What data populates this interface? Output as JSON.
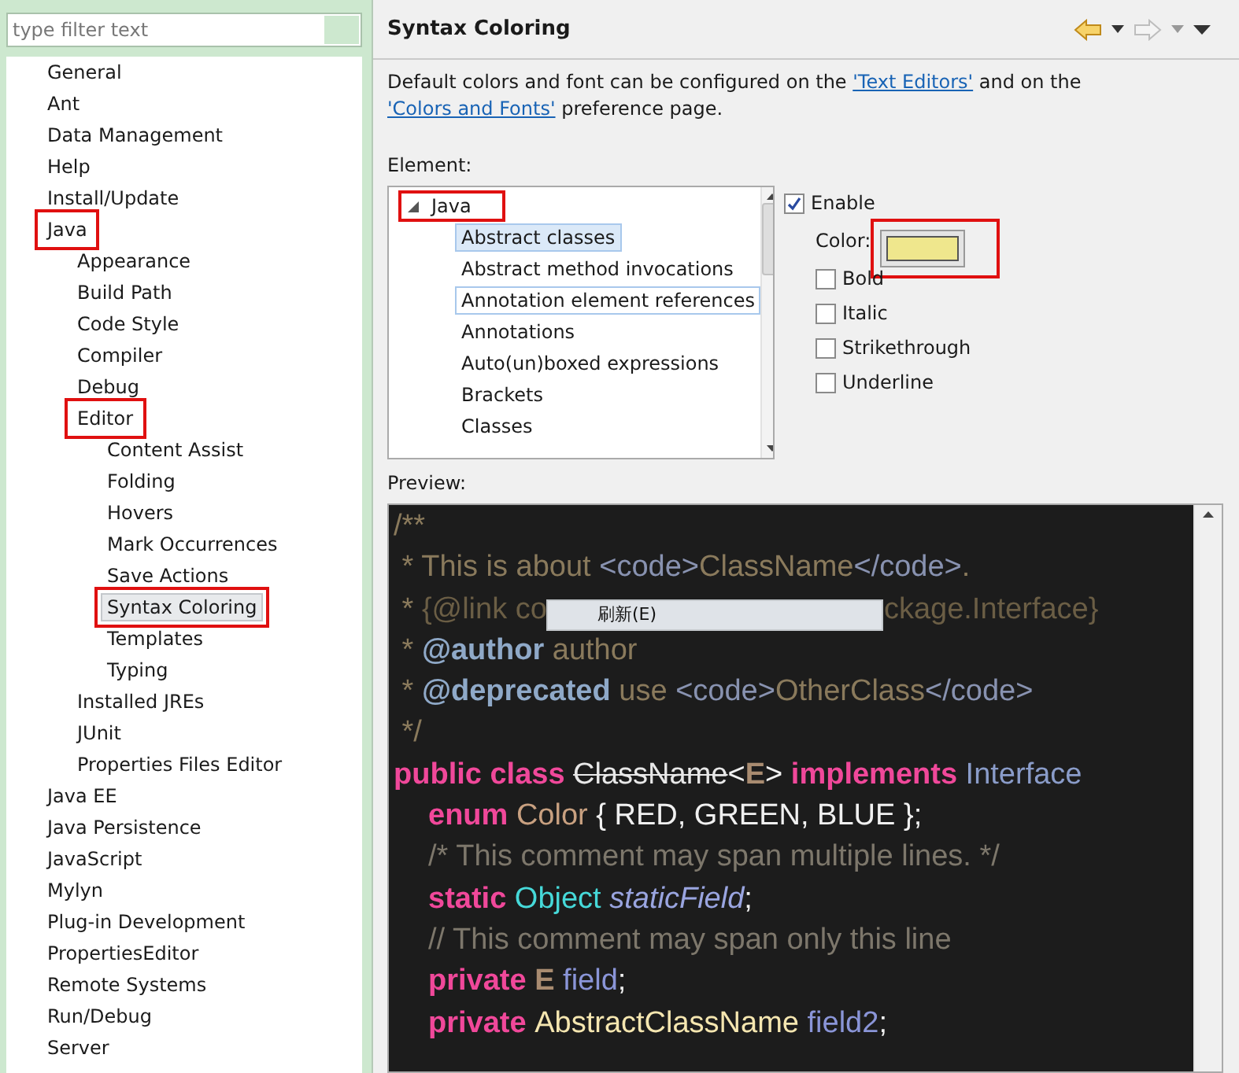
{
  "filter": {
    "placeholder": "type filter text"
  },
  "tree": [
    {
      "label": "General",
      "selected": false,
      "highlighted": false
    },
    {
      "label": "Ant",
      "selected": false,
      "highlighted": false
    },
    {
      "label": "Data Management",
      "selected": false,
      "highlighted": false
    },
    {
      "label": "Help",
      "selected": false,
      "highlighted": false
    },
    {
      "label": "Install/Update",
      "selected": false,
      "highlighted": false
    },
    {
      "label": "Java",
      "selected": false,
      "highlighted": true,
      "children": [
        {
          "label": "Appearance",
          "selected": false,
          "highlighted": false
        },
        {
          "label": "Build Path",
          "selected": false,
          "highlighted": false
        },
        {
          "label": "Code Style",
          "selected": false,
          "highlighted": false
        },
        {
          "label": "Compiler",
          "selected": false,
          "highlighted": false
        },
        {
          "label": "Debug",
          "selected": false,
          "highlighted": false
        },
        {
          "label": "Editor",
          "selected": false,
          "highlighted": true,
          "children": [
            {
              "label": "Content Assist",
              "selected": false,
              "highlighted": false
            },
            {
              "label": "Folding",
              "selected": false,
              "highlighted": false
            },
            {
              "label": "Hovers",
              "selected": false,
              "highlighted": false
            },
            {
              "label": "Mark Occurrences",
              "selected": false,
              "highlighted": false
            },
            {
              "label": "Save Actions",
              "selected": false,
              "highlighted": false
            },
            {
              "label": "Syntax Coloring",
              "selected": true,
              "highlighted": true
            },
            {
              "label": "Templates",
              "selected": false,
              "highlighted": false
            },
            {
              "label": "Typing",
              "selected": false,
              "highlighted": false
            }
          ]
        },
        {
          "label": "Installed JREs",
          "selected": false,
          "highlighted": false
        },
        {
          "label": "JUnit",
          "selected": false,
          "highlighted": false
        },
        {
          "label": "Properties Files Editor",
          "selected": false,
          "highlighted": false
        }
      ]
    },
    {
      "label": "Java EE",
      "selected": false,
      "highlighted": false
    },
    {
      "label": "Java Persistence",
      "selected": false,
      "highlighted": false
    },
    {
      "label": "JavaScript",
      "selected": false,
      "highlighted": false
    },
    {
      "label": "Mylyn",
      "selected": false,
      "highlighted": false
    },
    {
      "label": "Plug-in Development",
      "selected": false,
      "highlighted": false
    },
    {
      "label": "PropertiesEditor",
      "selected": false,
      "highlighted": false
    },
    {
      "label": "Remote Systems",
      "selected": false,
      "highlighted": false
    },
    {
      "label": "Run/Debug",
      "selected": false,
      "highlighted": false
    },
    {
      "label": "Server",
      "selected": false,
      "highlighted": false
    }
  ],
  "page": {
    "title": "Syntax Coloring",
    "nav": [
      {
        "kind": "back",
        "disabled": false
      },
      {
        "kind": "forward",
        "disabled": true
      }
    ],
    "description": [
      {
        "kind": "text",
        "text": "Default colors and font can be configured on the "
      },
      {
        "kind": "link",
        "text": "'Text Editors'"
      },
      {
        "kind": "text",
        "text": " and on the "
      },
      {
        "kind": "link",
        "text": "'Colors and Fonts'"
      },
      {
        "kind": "text",
        "text": " preference page."
      }
    ],
    "element_label": "Element:",
    "elements": [
      {
        "label": "Java",
        "expanded": true,
        "highlighted": true,
        "children": [
          {
            "label": "Abstract classes",
            "selected": true,
            "focused": false
          },
          {
            "label": "Abstract method invocations",
            "selected": false,
            "focused": false
          },
          {
            "label": "Annotation element references",
            "selected": false,
            "focused": true
          },
          {
            "label": "Annotations",
            "selected": false,
            "focused": false
          },
          {
            "label": "Auto(un)boxed expressions",
            "selected": false,
            "focused": false
          },
          {
            "label": "Brackets",
            "selected": false,
            "focused": false
          },
          {
            "label": "Classes",
            "selected": false,
            "focused": false
          }
        ]
      }
    ],
    "enable": {
      "label": "Enable",
      "checked": true
    },
    "color_option": {
      "label": "Color:",
      "color": "#efe78d",
      "highlighted": true
    },
    "styles": [
      {
        "label": "Bold",
        "checked": false
      },
      {
        "label": "Italic",
        "checked": false
      },
      {
        "label": "Strikethrough",
        "checked": false
      },
      {
        "label": "Underline",
        "checked": false
      }
    ],
    "preview_label": "Preview:",
    "preview": [
      {
        "indented": false,
        "tokens": [
          {
            "kind": "comment",
            "text": "/**"
          }
        ]
      },
      {
        "indented": false,
        "tokens": [
          {
            "kind": "comment",
            "text": " * This is about "
          },
          {
            "kind": "doc-tag",
            "text": "<code>"
          },
          {
            "kind": "comment",
            "text": "ClassName"
          },
          {
            "kind": "doc-tag",
            "text": "</code>"
          },
          {
            "kind": "comment",
            "text": "."
          }
        ]
      },
      {
        "indented": false,
        "tokens": [
          {
            "kind": "comment",
            "text": " * "
          },
          {
            "kind": "doc-link",
            "text": "{@link co"
          },
          {
            "kind": "menu",
            "text": "刷新(E)"
          },
          {
            "kind": "doc-link",
            "text": "ckage.Interface}"
          }
        ]
      },
      {
        "indented": false,
        "tokens": [
          {
            "kind": "comment",
            "text": " * "
          },
          {
            "kind": "doc-keyword",
            "text": "@author"
          },
          {
            "kind": "comment",
            "text": " author"
          }
        ]
      },
      {
        "indented": false,
        "tokens": [
          {
            "kind": "comment",
            "text": " * "
          },
          {
            "kind": "doc-keyword",
            "text": "@deprecated"
          },
          {
            "kind": "comment",
            "text": " use "
          },
          {
            "kind": "doc-tag",
            "text": "<code>"
          },
          {
            "kind": "comment",
            "text": "OtherClass"
          },
          {
            "kind": "doc-tag",
            "text": "</code>"
          }
        ]
      },
      {
        "indented": false,
        "tokens": [
          {
            "kind": "comment",
            "text": " */"
          }
        ]
      },
      {
        "indented": false,
        "tokens": [
          {
            "kind": "keyword",
            "text": "public class "
          },
          {
            "kind": "deprecated-class",
            "text": "ClassName"
          },
          {
            "kind": "plain",
            "text": "<"
          },
          {
            "kind": "type-var",
            "text": "E"
          },
          {
            "kind": "plain",
            "text": "> "
          },
          {
            "kind": "keyword",
            "text": "implements "
          },
          {
            "kind": "interface",
            "text": "Interface"
          }
        ]
      },
      {
        "indented": true,
        "tokens": [
          {
            "kind": "keyword",
            "text": "enum "
          },
          {
            "kind": "enum",
            "text": "Color"
          },
          {
            "kind": "plain",
            "text": " { RED, GREEN, BLUE };"
          }
        ]
      },
      {
        "indented": true,
        "tokens": [
          {
            "kind": "code-comment",
            "text": "/* This comment may span multiple lines. */"
          }
        ]
      },
      {
        "indented": true,
        "tokens": [
          {
            "kind": "keyword",
            "text": "static "
          },
          {
            "kind": "class",
            "text": "Object "
          },
          {
            "kind": "static-field",
            "text": "staticField"
          },
          {
            "kind": "plain",
            "text": ";"
          }
        ]
      },
      {
        "indented": true,
        "tokens": [
          {
            "kind": "code-comment",
            "text": "// This comment may span only this line"
          }
        ]
      },
      {
        "indented": true,
        "tokens": [
          {
            "kind": "keyword",
            "text": "private "
          },
          {
            "kind": "type-var",
            "text": "E "
          },
          {
            "kind": "field",
            "text": "field"
          },
          {
            "kind": "plain",
            "text": ";"
          }
        ]
      },
      {
        "indented": true,
        "tokens": [
          {
            "kind": "keyword",
            "text": "private "
          },
          {
            "kind": "abstract-class",
            "text": "AbstractClassName "
          },
          {
            "kind": "field",
            "text": "field2"
          },
          {
            "kind": "plain",
            "text": ";"
          }
        ]
      }
    ]
  }
}
